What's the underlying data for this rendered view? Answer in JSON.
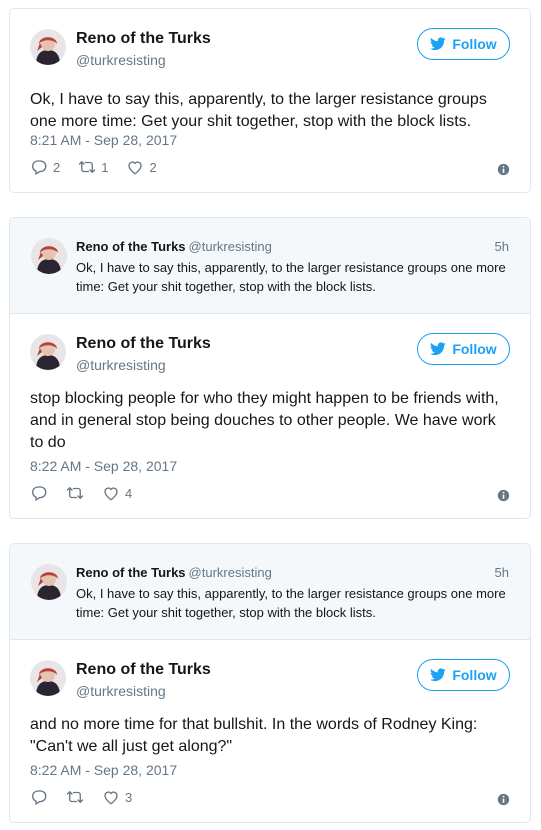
{
  "colors": {
    "accent": "#1da1f2",
    "secondary_text": "#657786",
    "border": "#e1e8ed",
    "quoted_bg": "#f5f8fa"
  },
  "icons": {
    "follow": "twitter-bird-icon",
    "reply": "reply-icon",
    "retweet": "retweet-icon",
    "like": "heart-icon",
    "info": "info-icon"
  },
  "tweet1": {
    "name": "Reno of the Turks",
    "handle": "@turkresisting",
    "follow_label": "Follow",
    "text": "Ok, I have to say this, apparently, to the larger resistance groups one more time: Get your shit together, stop with the block lists.",
    "time": "8:21 AM - Sep 28, 2017",
    "replies": "2",
    "retweets": "1",
    "likes": "2"
  },
  "tweet2": {
    "quoted": {
      "name": "Reno of the Turks",
      "handle": "@turkresisting",
      "time": "5h",
      "text": "Ok, I have to say this, apparently, to the larger resistance groups one more time: Get your shit together, stop with the block lists."
    },
    "name": "Reno of the Turks",
    "handle": "@turkresisting",
    "follow_label": "Follow",
    "text": "stop blocking people for who they might happen to be friends with, and in general stop being douches to other people. We have work to do",
    "time": "8:22 AM - Sep 28, 2017",
    "likes": "4"
  },
  "tweet3": {
    "quoted": {
      "name": "Reno of the Turks",
      "handle": "@turkresisting",
      "time": "5h",
      "text": "Ok, I have to say this, apparently, to the larger resistance groups one more time: Get your shit together, stop with the block lists."
    },
    "name": "Reno of the Turks",
    "handle": "@turkresisting",
    "follow_label": "Follow",
    "text": "and no more time for that bullshit. In the words of Rodney King: \"Can't we all just get along?\"",
    "time": "8:22 AM - Sep 28, 2017",
    "likes": "3"
  }
}
